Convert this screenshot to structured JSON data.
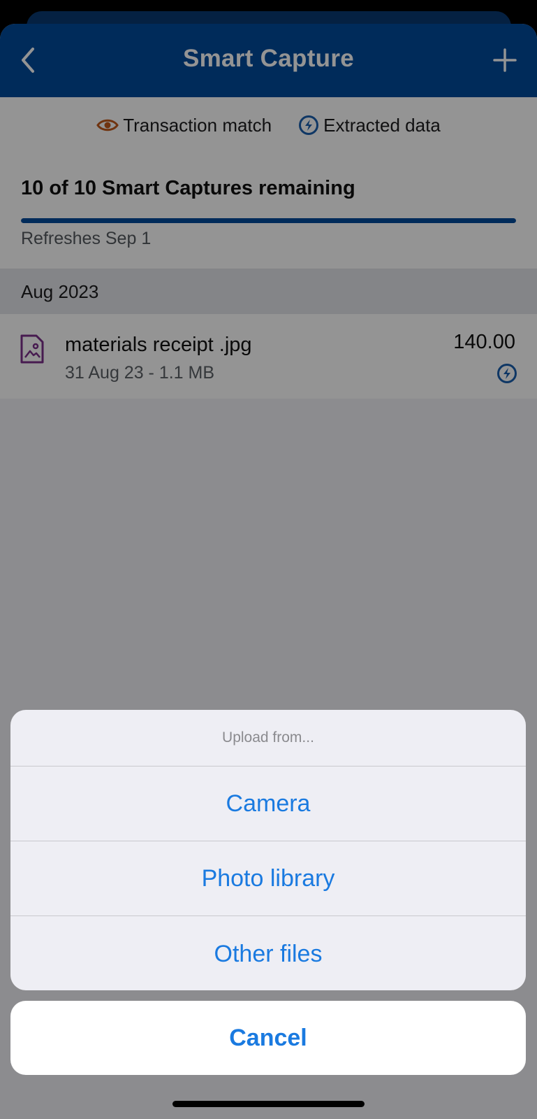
{
  "nav": {
    "title": "Smart Capture",
    "back_icon": "chevron-left-icon",
    "add_icon": "plus-icon"
  },
  "legend": {
    "transaction_match": {
      "label": "Transaction match",
      "icon": "eye-icon",
      "color": "#c25a1c"
    },
    "extracted_data": {
      "label": "Extracted data",
      "icon": "bolt-circle-icon",
      "color": "#1a5fae"
    }
  },
  "quota": {
    "title": "10 of 10 Smart Captures remaining",
    "progress": 1.0,
    "refresh": "Refreshes Sep 1"
  },
  "section": {
    "label": "Aug 2023"
  },
  "files": [
    {
      "name": "materials receipt .jpg",
      "meta": "31 Aug 23 - 1.1 MB",
      "amount": "140.00",
      "icon": "image-file-icon",
      "badge": "bolt-circle-icon"
    }
  ],
  "action_sheet": {
    "title": "Upload from...",
    "options": [
      "Camera",
      "Photo library",
      "Other files"
    ],
    "cancel": "Cancel"
  },
  "colors": {
    "brand": "#004b9c",
    "action": "#1a7ae0",
    "file_icon": "#7a2f8a"
  }
}
